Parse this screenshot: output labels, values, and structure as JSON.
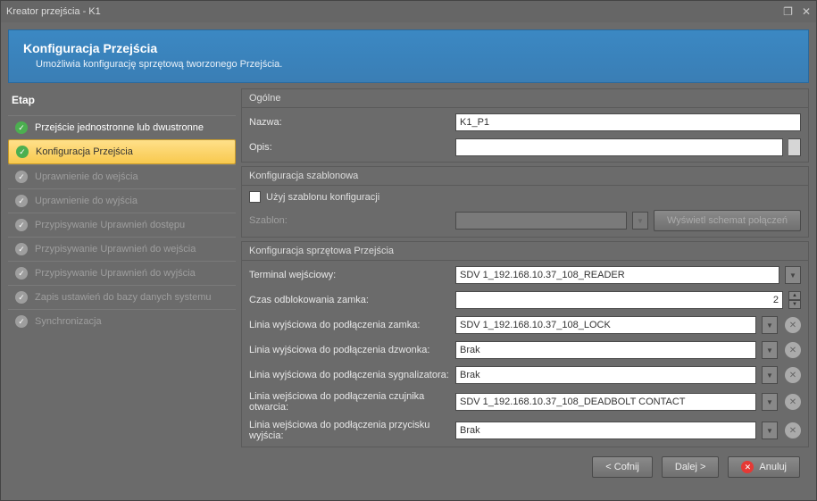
{
  "window": {
    "title": "Kreator przejścia - K1"
  },
  "banner": {
    "title": "Konfiguracja Przejścia",
    "subtitle": "Umożliwia konfigurację sprzętową tworzonego Przejścia."
  },
  "sidebar": {
    "title": "Etap",
    "steps": [
      {
        "label": "Przejście jednostronne lub dwustronne",
        "state": "done"
      },
      {
        "label": "Konfiguracja Przejścia",
        "state": "current"
      },
      {
        "label": "Uprawnienie do wejścia",
        "state": "disabled"
      },
      {
        "label": "Uprawnienie do wyjścia",
        "state": "disabled"
      },
      {
        "label": "Przypisywanie Uprawnień dostępu",
        "state": "disabled"
      },
      {
        "label": "Przypisywanie Uprawnień do wejścia",
        "state": "disabled"
      },
      {
        "label": "Przypisywanie Uprawnień do wyjścia",
        "state": "disabled"
      },
      {
        "label": "Zapis ustawień do bazy danych systemu",
        "state": "disabled"
      },
      {
        "label": "Synchronizacja",
        "state": "disabled"
      }
    ]
  },
  "general": {
    "header": "Ogólne",
    "name_label": "Nazwa:",
    "name_value": "K1_P1",
    "desc_label": "Opis:",
    "desc_value": ""
  },
  "template": {
    "header": "Konfiguracja szablonowa",
    "use_label": "Użyj szablonu konfiguracji",
    "template_label": "Szablon:",
    "template_value": "",
    "show_schema_btn": "Wyświetl schemat połączeń"
  },
  "hardware": {
    "header": "Konfiguracja sprzętowa Przejścia",
    "terminal_label": "Terminal wejściowy:",
    "terminal_value": "SDV 1_192.168.10.37_108_READER",
    "unlock_label": "Czas odblokowania zamka:",
    "unlock_value": "2",
    "lock_line_label": "Linia wyjściowa do podłączenia zamka:",
    "lock_line_value": "SDV 1_192.168.10.37_108_LOCK",
    "bell_line_label": "Linia wyjściowa do podłączenia dzwonka:",
    "bell_line_value": "Brak",
    "signal_line_label": "Linia wyjściowa do podłączenia sygnalizatora:",
    "signal_line_value": "Brak",
    "sensor_line_label": "Linia wejściowa do podłączenia czujnika otwarcia:",
    "sensor_line_value": "SDV 1_192.168.10.37_108_DEADBOLT CONTACT",
    "exit_btn_line_label": "Linia wejściowa do podłączenia przycisku wyjścia:",
    "exit_btn_line_value": "Brak"
  },
  "footer": {
    "back": "< Cofnij",
    "next": "Dalej >",
    "cancel": "Anuluj"
  }
}
